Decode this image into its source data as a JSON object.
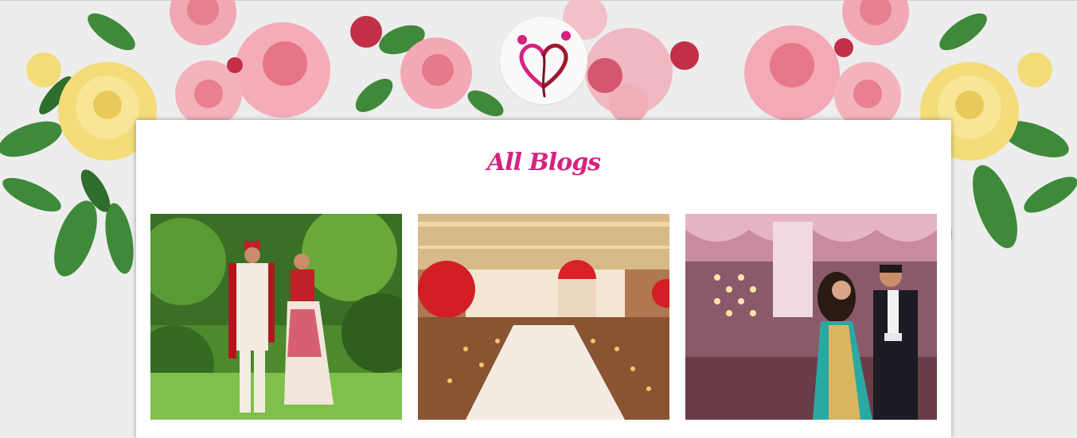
{
  "header": {
    "logo_icon": "hearts-couple-logo-icon",
    "decoration": "floral-garland"
  },
  "main": {
    "title": "All Blogs",
    "posts": [
      {
        "image": "couple-in-garden-photo"
      },
      {
        "image": "decorated-wedding-aisle-photo"
      },
      {
        "image": "couple-dancing-photo"
      }
    ]
  },
  "colors": {
    "accent": "#d4237f",
    "background": "#ededed",
    "card": "#ffffff"
  }
}
